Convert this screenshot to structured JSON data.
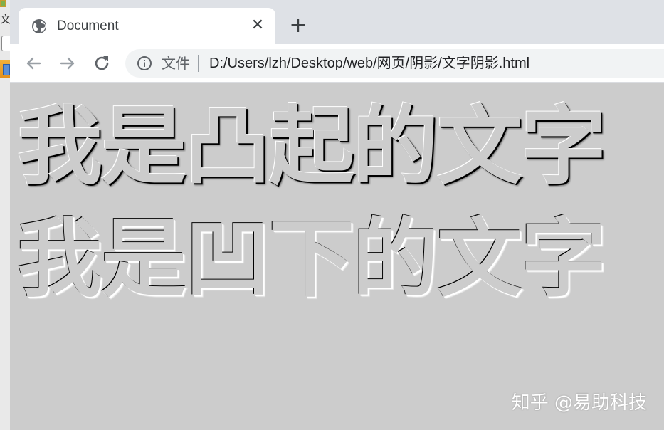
{
  "left_window": {
    "partial_char": "文"
  },
  "tab": {
    "title": "Document",
    "icon": "globe-icon",
    "close_glyph": "✕"
  },
  "new_tab_glyph": "+",
  "toolbar": {
    "back_icon": "arrow-left-icon",
    "forward_icon": "arrow-right-icon",
    "reload_icon": "reload-icon"
  },
  "address_bar": {
    "info_icon": "info-icon",
    "scheme_label": "文件",
    "url": "D:/Users/lzh/Desktop/web/网页/阴影/文字阴影.html"
  },
  "page": {
    "raised_text": "我是凸起的文字",
    "sunken_text": "我是凹下的文字",
    "background_color": "#cccccc"
  },
  "watermark": {
    "text": "知乎 @易助科技"
  },
  "colors": {
    "tab_strip": "#dee1e6",
    "omnibox": "#f1f3f4",
    "text_dark": "#3c4043"
  }
}
